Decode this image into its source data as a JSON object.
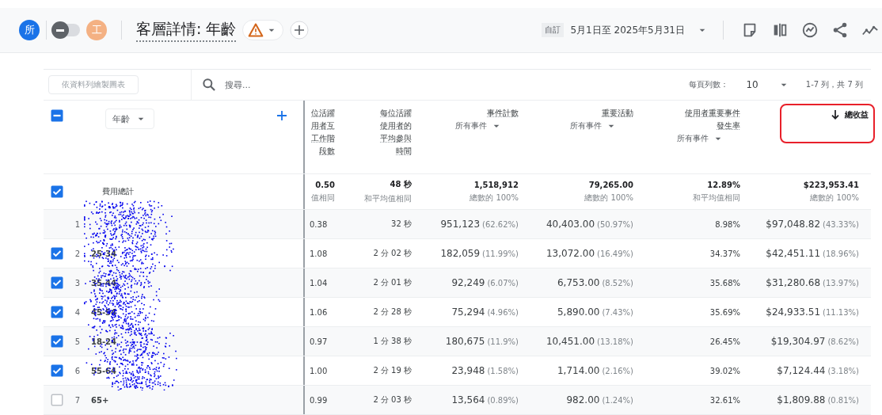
{
  "header": {
    "avatars": [
      {
        "text": "所",
        "color": "#1a73e8"
      },
      {
        "text": "工",
        "color": "#f4b183"
      }
    ],
    "toggle": {
      "on": false
    },
    "title": "客層詳情: 年齡",
    "date_range": {
      "label": "自訂",
      "value": "5月1日至 2025年5月31日"
    }
  },
  "toolbar": {
    "chart_button": "依資料列繪製圖表",
    "search": {
      "placeholder": "搜尋..."
    },
    "rows_per_page_label": "每頁列數：",
    "rows_per_page": "10",
    "pagination": "1-7 列，共 7 列"
  },
  "table": {
    "select_all": {
      "checked": true,
      "indeterminate": true
    },
    "dimension": "年齡",
    "columns": [
      {
        "title": "位活躍用者互工作階段數",
        "highlighted": false,
        "sorted": false
      },
      {
        "title": "每位活躍使用者的平均參與時間",
        "highlighted": false,
        "sorted": false
      },
      {
        "title": "事件計數",
        "filter": "所有事件",
        "highlighted": false,
        "sorted": false
      },
      {
        "title": "重要活動",
        "filter": "所有事件",
        "highlighted": false,
        "sorted": false
      },
      {
        "title": "使用者重要事件發生率",
        "filter": "所有事件",
        "highlighted": false,
        "sorted": false
      },
      {
        "title": "總收益",
        "highlighted": true,
        "sorted": true
      }
    ],
    "totals": {
      "checked": true,
      "label": "費用總計",
      "cells": [
        {
          "value": "0.50",
          "note": "值相同"
        },
        {
          "value": "48 秒",
          "note": "和平均值相同"
        },
        {
          "value": "1,518,912",
          "note": "總數的 100%"
        },
        {
          "value": "79,265.00",
          "note": "總數的 100%"
        },
        {
          "value": "12.89%",
          "note": "和平均值相同"
        },
        {
          "value": "$223,953.41",
          "note": "總數的 100%"
        }
      ]
    },
    "rows": [
      {
        "index": "1",
        "kind": "plain",
        "cells": [
          {
            "value": "0.38"
          },
          {
            "value": "32 秒"
          },
          {
            "value": "951,123",
            "share": "(62.62%)"
          },
          {
            "value": "40,403.00",
            "share": "(50.97%)"
          },
          {
            "value": "8.98%"
          },
          {
            "value": "$97,048.82",
            "share": "(43.33%)"
          }
        ]
      },
      {
        "index": "2",
        "kind": "selectable",
        "checked": true,
        "label": "25-34",
        "cells": [
          {
            "value": "1.08"
          },
          {
            "value": "2 分 02 秒"
          },
          {
            "value": "182,059",
            "share": "(11.99%)"
          },
          {
            "value": "13,072.00",
            "share": "(16.49%)"
          },
          {
            "value": "34.37%"
          },
          {
            "value": "$42,451.11",
            "share": "(18.96%)"
          }
        ]
      },
      {
        "index": "3",
        "kind": "selectable",
        "checked": true,
        "label": "35-44",
        "cells": [
          {
            "value": "1.04"
          },
          {
            "value": "2 分 01 秒"
          },
          {
            "value": "92,249",
            "share": "(6.07%)"
          },
          {
            "value": "6,753.00",
            "share": "(8.52%)"
          },
          {
            "value": "35.68%"
          },
          {
            "value": "$31,280.68",
            "share": "(13.97%)"
          }
        ]
      },
      {
        "index": "4",
        "kind": "selectable",
        "checked": true,
        "label": "45-54",
        "cells": [
          {
            "value": "1.06"
          },
          {
            "value": "2 分 28 秒"
          },
          {
            "value": "75,294",
            "share": "(4.96%)"
          },
          {
            "value": "5,890.00",
            "share": "(7.43%)"
          },
          {
            "value": "35.69%"
          },
          {
            "value": "$24,933.51",
            "share": "(11.13%)"
          }
        ]
      },
      {
        "index": "5",
        "kind": "selectable",
        "checked": true,
        "label": "18-24",
        "cells": [
          {
            "value": "0.97"
          },
          {
            "value": "1 分 38 秒"
          },
          {
            "value": "180,675",
            "share": "(11.9%)"
          },
          {
            "value": "10,451.00",
            "share": "(13.18%)"
          },
          {
            "value": "26.45%"
          },
          {
            "value": "$19,304.97",
            "share": "(8.62%)"
          }
        ]
      },
      {
        "index": "6",
        "kind": "selectable",
        "checked": true,
        "label": "55-64",
        "cells": [
          {
            "value": "1.00"
          },
          {
            "value": "2 分 19 秒"
          },
          {
            "value": "23,948",
            "share": "(1.58%)"
          },
          {
            "value": "1,714.00",
            "share": "(2.16%)"
          },
          {
            "value": "39.02%"
          },
          {
            "value": "$7,124.44",
            "share": "(3.18%)"
          }
        ]
      },
      {
        "index": "7",
        "kind": "selectable",
        "checked": false,
        "label": "65+",
        "cells": [
          {
            "value": "0.99"
          },
          {
            "value": "2 分 03 秒"
          },
          {
            "value": "13,564",
            "share": "(0.89%)"
          },
          {
            "value": "982.00",
            "share": "(1.24%)"
          },
          {
            "value": "32.61%"
          },
          {
            "value": "$1,809.88",
            "share": "(0.81%)"
          }
        ]
      }
    ]
  }
}
